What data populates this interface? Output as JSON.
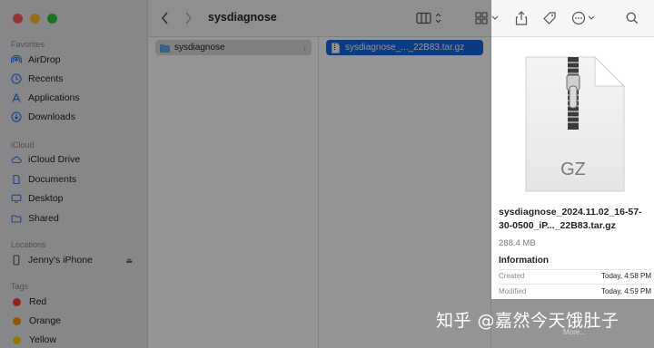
{
  "window": {
    "title": "sysdiagnose"
  },
  "sidebar": {
    "sections": [
      {
        "title": "Favorites",
        "items": [
          {
            "label": "AirDrop",
            "icon": "airdrop-icon"
          },
          {
            "label": "Recents",
            "icon": "clock-icon"
          },
          {
            "label": "Applications",
            "icon": "applications-icon"
          },
          {
            "label": "Downloads",
            "icon": "download-icon"
          }
        ]
      },
      {
        "title": "iCloud",
        "items": [
          {
            "label": "iCloud Drive",
            "icon": "cloud-icon"
          },
          {
            "label": "Documents",
            "icon": "document-icon"
          },
          {
            "label": "Desktop",
            "icon": "desktop-icon"
          },
          {
            "label": "Shared",
            "icon": "shared-folder-icon"
          }
        ]
      },
      {
        "title": "Locations",
        "items": [
          {
            "label": "Jenny's iPhone",
            "icon": "iphone-icon"
          }
        ]
      },
      {
        "title": "Tags",
        "items": [
          {
            "label": "Red",
            "color": "#fe3b30"
          },
          {
            "label": "Orange",
            "color": "#ff9500"
          },
          {
            "label": "Yellow",
            "color": "#ffcc00"
          }
        ]
      }
    ]
  },
  "columns": {
    "col1": {
      "item": "sysdiagnose",
      "chevron": "›"
    },
    "col2": {
      "item": "sysdiagnose_..._22B83.tar.gz"
    }
  },
  "preview": {
    "badge": "GZ",
    "name": "sysdiagnose_2024.11.02_16-57-30-0500_iP..._22B83.tar.gz",
    "size": "288.4 MB",
    "section": "Information",
    "rows": [
      {
        "key": "Created",
        "value": "Today, 4:58 PM"
      },
      {
        "key": "Modified",
        "value": "Today, 4:59 PM"
      }
    ],
    "more": "More..."
  },
  "watermark": "知乎 @嘉然今天饿肚子",
  "colors": {
    "accent": "#1565e2",
    "sidebar": "#e9e9ec"
  }
}
